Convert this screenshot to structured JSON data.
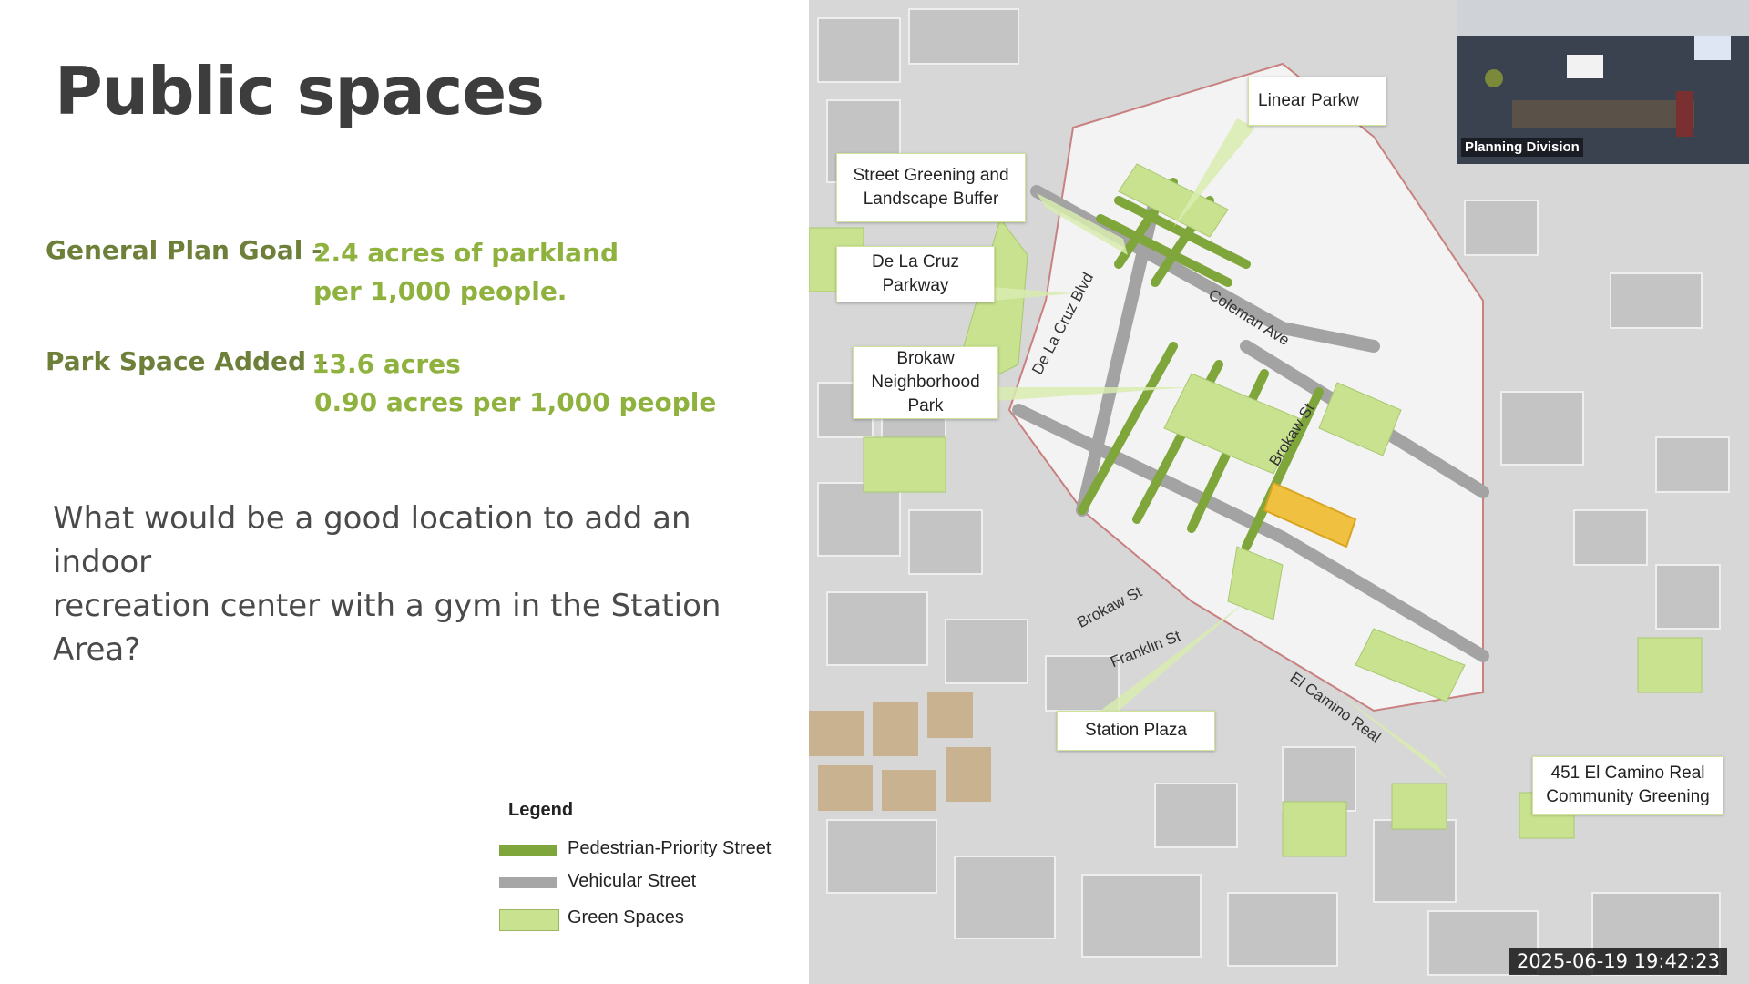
{
  "slide": {
    "title": "Public spaces",
    "goal_label": "General Plan Goal -",
    "goal_value_line1": "2.4 acres of parkland",
    "goal_value_line2": "per 1,000 people.",
    "added_label": "Park Space Added –",
    "added_value_line1": "13.6 acres",
    "added_value_line2": "0.90 acres per 1,000 people",
    "question_line1": "What would be a good location to add an indoor",
    "question_line2": "recreation center with a gym in the Station Area?",
    "legend": {
      "title": "Legend",
      "items": [
        {
          "label": "Pedestrian-Priority Street",
          "color": "#7fa63a"
        },
        {
          "label": "Vehicular Street",
          "color": "#a6a6a6"
        },
        {
          "label": "Green Spaces",
          "color": "#c8e290"
        }
      ]
    }
  },
  "map": {
    "callouts": {
      "linear_park": "Linear Parkw",
      "street_greening": "Street Greening and Landscape Buffer",
      "de_la_cruz": "De La Cruz Parkway",
      "brokaw_park": "Brokaw Neighborhood Park",
      "station_plaza": "Station Plaza",
      "community_greening": "451 El Camino Real Community Greening"
    },
    "streets": {
      "de_la_cruz_blvd": "De La Cruz Blvd",
      "coleman_ave": "Coleman Ave",
      "brokaw_st_1": "Brokaw St",
      "brokaw_st_2": "Brokaw St",
      "franklin_st": "Franklin St",
      "el_camino_real": "El Camino Real"
    }
  },
  "video": {
    "label": "Planning Division"
  },
  "timestamp": "2025-06-19  19:42:23"
}
